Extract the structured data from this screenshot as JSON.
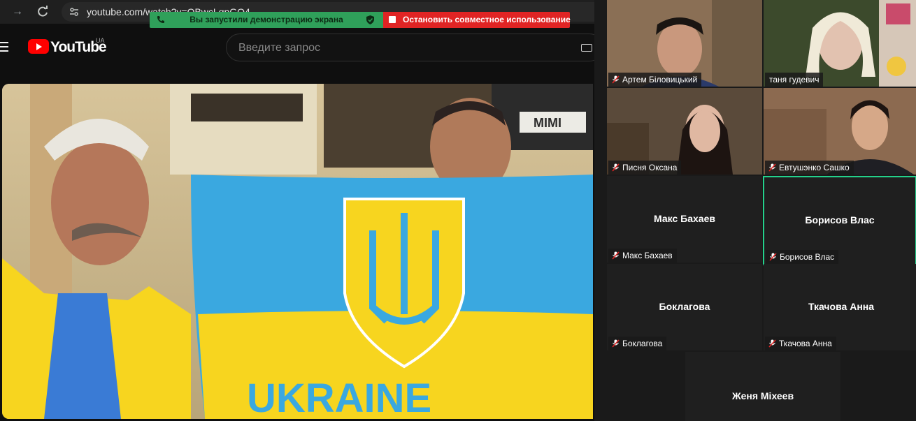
{
  "browser": {
    "url": "youtube.com/watch?v=QBwcLgpGO4",
    "share_banner": {
      "status_text": "Вы запустили демонстрацию экрана",
      "stop_label": "Остановить совместное использование"
    },
    "youtube": {
      "logo_text": "YouTube",
      "region": "UA",
      "search_placeholder": "Введите запрос"
    },
    "video": {
      "flag_text": "UKRAINE",
      "sign_text": "MIMI"
    }
  },
  "meeting": {
    "participants": [
      {
        "name": "Артем Біловицький",
        "muted": true,
        "video": true
      },
      {
        "name": "таня гудевич",
        "muted": false,
        "video": true
      },
      {
        "name": "Писня Оксана",
        "muted": true,
        "video": true
      },
      {
        "name": "Евтушэнко Сашко",
        "muted": true,
        "video": true
      },
      {
        "name": "Макс Бахаев",
        "muted": true,
        "video": false
      },
      {
        "name": "Борисов Влас",
        "muted": true,
        "video": false,
        "active_speaker": true
      },
      {
        "name": "Боклагова",
        "muted": true,
        "video": false
      },
      {
        "name": "Ткачова Анна",
        "muted": true,
        "video": false
      },
      {
        "name": "Женя Міхеев",
        "muted": false,
        "video": false
      }
    ]
  },
  "colors": {
    "accent_green": "#23d18b",
    "banner_green": "#2fa05a",
    "banner_red": "#e02424",
    "youtube_red": "#ff0000",
    "flag_blue": "#3aa8e0",
    "flag_yellow": "#f7d51f"
  },
  "icons": {
    "back": "arrow-left-icon",
    "reload": "reload-icon",
    "site_info": "tune-icon",
    "phone": "phone-icon",
    "shield": "shield-check-icon",
    "stop": "stop-square-icon",
    "menu": "hamburger-icon",
    "keyboard": "keyboard-icon",
    "muted_mic": "muted-mic-icon"
  }
}
